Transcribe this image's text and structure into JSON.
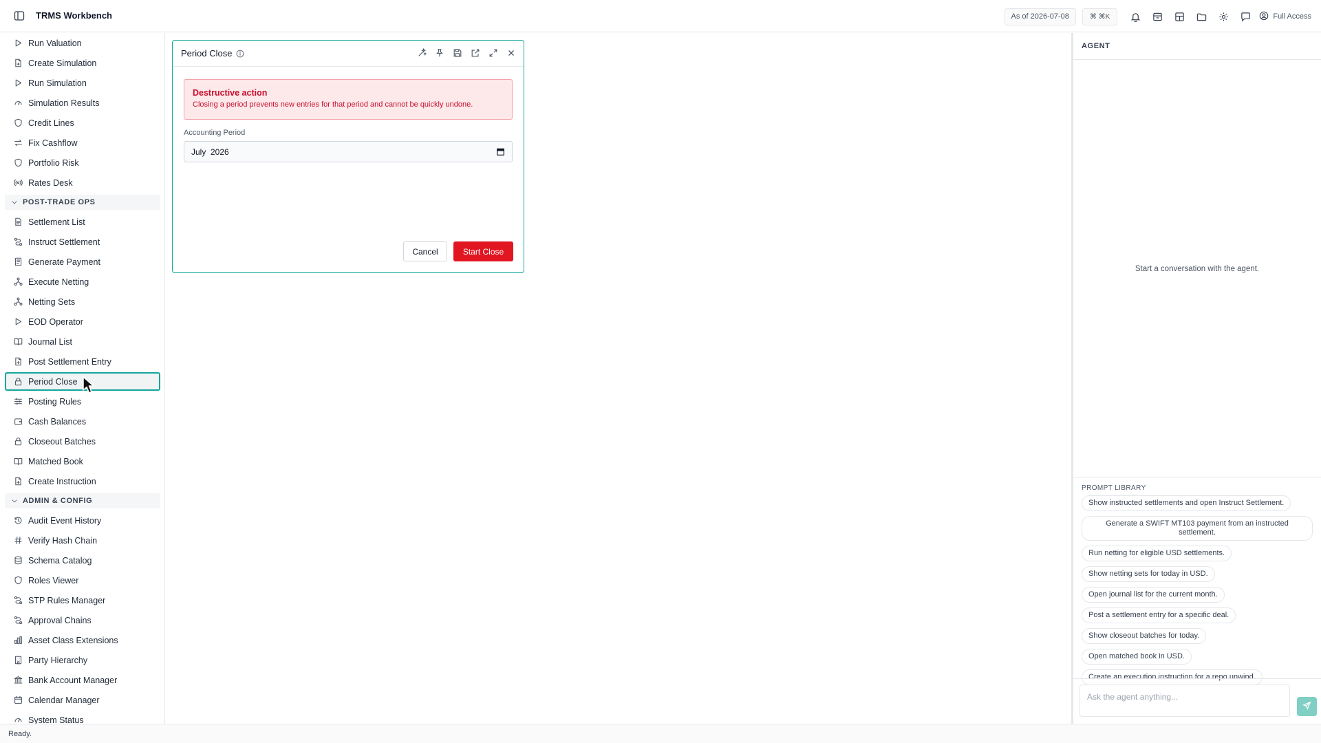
{
  "app": {
    "title": "TRMS Workbench"
  },
  "topbar": {
    "as_of": "As of 2026-07-08",
    "shortcut": "⌘ ⌘K",
    "access": "Full Access"
  },
  "sidebar": {
    "items_top": [
      {
        "label": "Run Valuation",
        "icon": "play-icon"
      },
      {
        "label": "Create Simulation",
        "icon": "file-plus-icon"
      },
      {
        "label": "Run Simulation",
        "icon": "play-icon"
      },
      {
        "label": "Simulation Results",
        "icon": "gauge-icon"
      },
      {
        "label": "Credit Lines",
        "icon": "shield-icon"
      },
      {
        "label": "Fix Cashflow",
        "icon": "arrows-swap-icon"
      },
      {
        "label": "Portfolio Risk",
        "icon": "shield-icon"
      },
      {
        "label": "Rates Desk",
        "icon": "broadcast-icon"
      }
    ],
    "section_post_trade": "POST-TRADE OPS",
    "items_post_trade": [
      {
        "label": "Settlement List",
        "icon": "file-text-icon"
      },
      {
        "label": "Instruct Settlement",
        "icon": "route-icon"
      },
      {
        "label": "Generate Payment",
        "icon": "receipt-icon"
      },
      {
        "label": "Execute Netting",
        "icon": "network-icon"
      },
      {
        "label": "Netting Sets",
        "icon": "network-icon"
      },
      {
        "label": "EOD Operator",
        "icon": "play-icon"
      },
      {
        "label": "Journal List",
        "icon": "book-icon"
      },
      {
        "label": "Post Settlement Entry",
        "icon": "file-plus-icon"
      },
      {
        "label": "Period Close",
        "icon": "lock-icon"
      },
      {
        "label": "Posting Rules",
        "icon": "sliders-icon"
      },
      {
        "label": "Cash Balances",
        "icon": "wallet-icon"
      },
      {
        "label": "Closeout Batches",
        "icon": "lock-icon"
      },
      {
        "label": "Matched Book",
        "icon": "book-icon"
      },
      {
        "label": "Create Instruction",
        "icon": "file-plus-icon"
      }
    ],
    "section_admin": "ADMIN & CONFIG",
    "items_admin": [
      {
        "label": "Audit Event History",
        "icon": "history-icon"
      },
      {
        "label": "Verify Hash Chain",
        "icon": "hash-icon"
      },
      {
        "label": "Schema Catalog",
        "icon": "database-icon"
      },
      {
        "label": "Roles Viewer",
        "icon": "shield-icon"
      },
      {
        "label": "STP Rules Manager",
        "icon": "route-icon"
      },
      {
        "label": "Approval Chains",
        "icon": "route-icon"
      },
      {
        "label": "Asset Class Extensions",
        "icon": "chart-icon"
      },
      {
        "label": "Party Hierarchy",
        "icon": "building-icon"
      },
      {
        "label": "Bank Account Manager",
        "icon": "bank-icon"
      },
      {
        "label": "Calendar Manager",
        "icon": "calendar-icon"
      },
      {
        "label": "System Status",
        "icon": "gauge-icon"
      }
    ],
    "active_item": "Period Close"
  },
  "panel": {
    "title": "Period Close",
    "alert_title": "Destructive action",
    "alert_text": "Closing a period prevents new entries for that period and cannot be quickly undone.",
    "field_label": "Accounting Period",
    "field_value": "July  2026",
    "cancel_label": "Cancel",
    "start_label": "Start Close"
  },
  "agent": {
    "header": "AGENT",
    "empty_text": "Start a conversation with the agent.",
    "library_title": "PROMPT LIBRARY",
    "prompts": [
      "Show instructed settlements and open Instruct Settlement.",
      "Generate a SWIFT MT103 payment from an instructed settlement.",
      "Run netting for eligible USD settlements.",
      "Show netting sets for today in USD.",
      "Open journal list for the current month.",
      "Post a settlement entry for a specific deal.",
      "Show closeout batches for today.",
      "Open matched book in USD.",
      "Create an execution instruction for a repo unwind."
    ],
    "input_placeholder": "Ask the agent anything..."
  },
  "status": {
    "text": "Ready."
  },
  "colors": {
    "accent": "#14a69b",
    "danger": "#e11621",
    "alert_bg": "#fde8ea"
  }
}
